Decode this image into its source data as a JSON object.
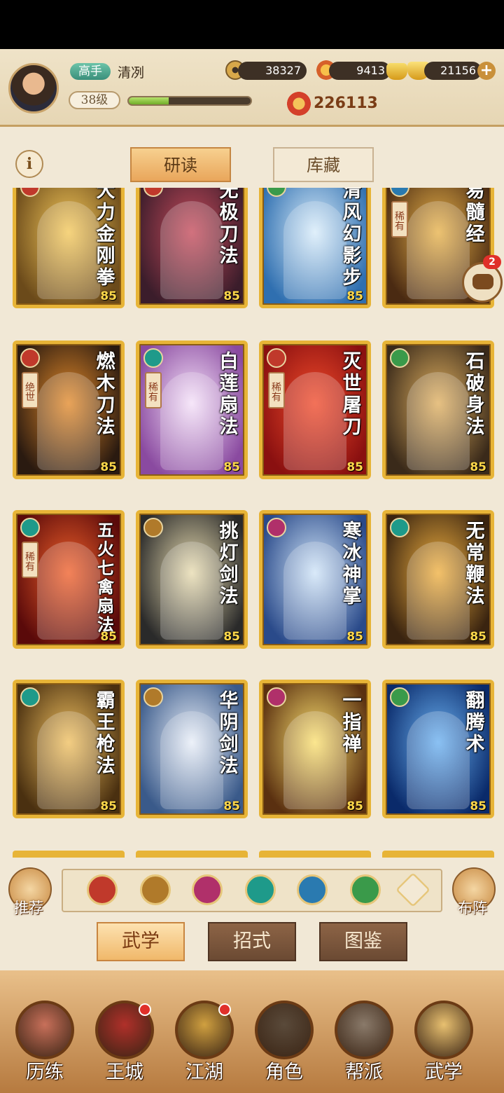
{
  "header": {
    "player_rank": "高手",
    "player_name": "清冽",
    "level": "38级",
    "exp_fraction": 0.33,
    "coins": "38327",
    "tokens": "9413",
    "ingots": "21156",
    "power": "226113"
  },
  "tabs": [
    {
      "label": "研读",
      "active": true
    },
    {
      "label": "库藏",
      "active": false
    }
  ],
  "cards": [
    {
      "name": "大力金刚拳",
      "level": "85",
      "type_color": "#c0392b",
      "bg": [
        "#6b4a1a",
        "#f4c85a"
      ],
      "rarity": ""
    },
    {
      "name": "无极刀法",
      "level": "85",
      "type_color": "#c0392b",
      "bg": [
        "#3b1d2b",
        "#c54a5a"
      ],
      "rarity": ""
    },
    {
      "name": "清风幻影步",
      "level": "85",
      "type_color": "#3a9a4a",
      "bg": [
        "#2f6fb0",
        "#d8ecfa"
      ],
      "rarity": ""
    },
    {
      "name": "易髓经",
      "level": "85",
      "type_color": "#2a7ab0",
      "bg": [
        "#4a2a12",
        "#e8b24a"
      ],
      "rarity": "稀有"
    },
    {
      "name": "燃木刀法",
      "level": "85",
      "type_color": "#c0392b",
      "bg": [
        "#2a1a10",
        "#e38a2a"
      ],
      "rarity": "绝世"
    },
    {
      "name": "白莲扇法",
      "level": "85",
      "type_color": "#1e9a8a",
      "bg": [
        "#8a4aa0",
        "#f4e0f8"
      ],
      "rarity": "稀有"
    },
    {
      "name": "灭世屠刀",
      "level": "85",
      "type_color": "#c0392b",
      "bg": [
        "#8a1010",
        "#f04a2a"
      ],
      "rarity": "稀有"
    },
    {
      "name": "石破身法",
      "level": "85",
      "type_color": "#3a9a4a",
      "bg": [
        "#3a2a1a",
        "#e0b060"
      ],
      "rarity": ""
    },
    {
      "name": "五火七禽扇法",
      "level": "85",
      "type_color": "#1e9a8a",
      "bg": [
        "#5a0a0a",
        "#f0602a"
      ],
      "rarity": "稀有"
    },
    {
      "name": "挑灯剑法",
      "level": "85",
      "type_color": "#b07a2a",
      "bg": [
        "#2a2a2a",
        "#e8dcb0"
      ],
      "rarity": ""
    },
    {
      "name": "寒冰神掌",
      "level": "85",
      "type_color": "#b0306a",
      "bg": [
        "#2a4a8a",
        "#cfe4f8"
      ],
      "rarity": ""
    },
    {
      "name": "无常鞭法",
      "level": "85",
      "type_color": "#1e9a8a",
      "bg": [
        "#3a2410",
        "#f0b040"
      ],
      "rarity": ""
    },
    {
      "name": "霸王枪法",
      "level": "85",
      "type_color": "#1e9a8a",
      "bg": [
        "#4a3010",
        "#f0c060"
      ],
      "rarity": ""
    },
    {
      "name": "华阴剑法",
      "level": "85",
      "type_color": "#b07a2a",
      "bg": [
        "#3a5a8a",
        "#e8eef8"
      ],
      "rarity": ""
    },
    {
      "name": "一指禅",
      "level": "85",
      "type_color": "#b0306a",
      "bg": [
        "#5a3010",
        "#fbe070"
      ],
      "rarity": ""
    },
    {
      "name": "翻腾术",
      "level": "85",
      "type_color": "#3a9a4a",
      "bg": [
        "#0a2a6a",
        "#6ab0f0"
      ],
      "rarity": ""
    }
  ],
  "chat": {
    "badge": "2"
  },
  "filter": {
    "left_label": "推荐",
    "right_label": "布阵",
    "icons": [
      {
        "name": "blade-filter-icon",
        "color": "#c0392b"
      },
      {
        "name": "sword-filter-icon",
        "color": "#b07a2a"
      },
      {
        "name": "fist-filter-icon",
        "color": "#b0306a"
      },
      {
        "name": "fan-filter-icon",
        "color": "#1e9a8a"
      },
      {
        "name": "taiji-filter-icon",
        "color": "#2a7ab0"
      },
      {
        "name": "step-filter-icon",
        "color": "#3a9a4a"
      },
      {
        "name": "all-filter-icon",
        "color": "#f3e9d5"
      }
    ]
  },
  "subtabs": [
    {
      "label": "武学",
      "active": true
    },
    {
      "label": "招式",
      "active": false
    },
    {
      "label": "图鉴",
      "active": false
    }
  ],
  "nav": [
    {
      "label": "历练",
      "color": "#c8705a",
      "dot": false
    },
    {
      "label": "王城",
      "color": "#b0302a",
      "dot": true
    },
    {
      "label": "江湖",
      "color": "#d0a040",
      "dot": true
    },
    {
      "label": "角色",
      "color": "#5a4a3a",
      "dot": false
    },
    {
      "label": "帮派",
      "color": "#8a7a6a",
      "dot": false
    },
    {
      "label": "武学",
      "color": "#e8c070",
      "dot": false
    }
  ]
}
